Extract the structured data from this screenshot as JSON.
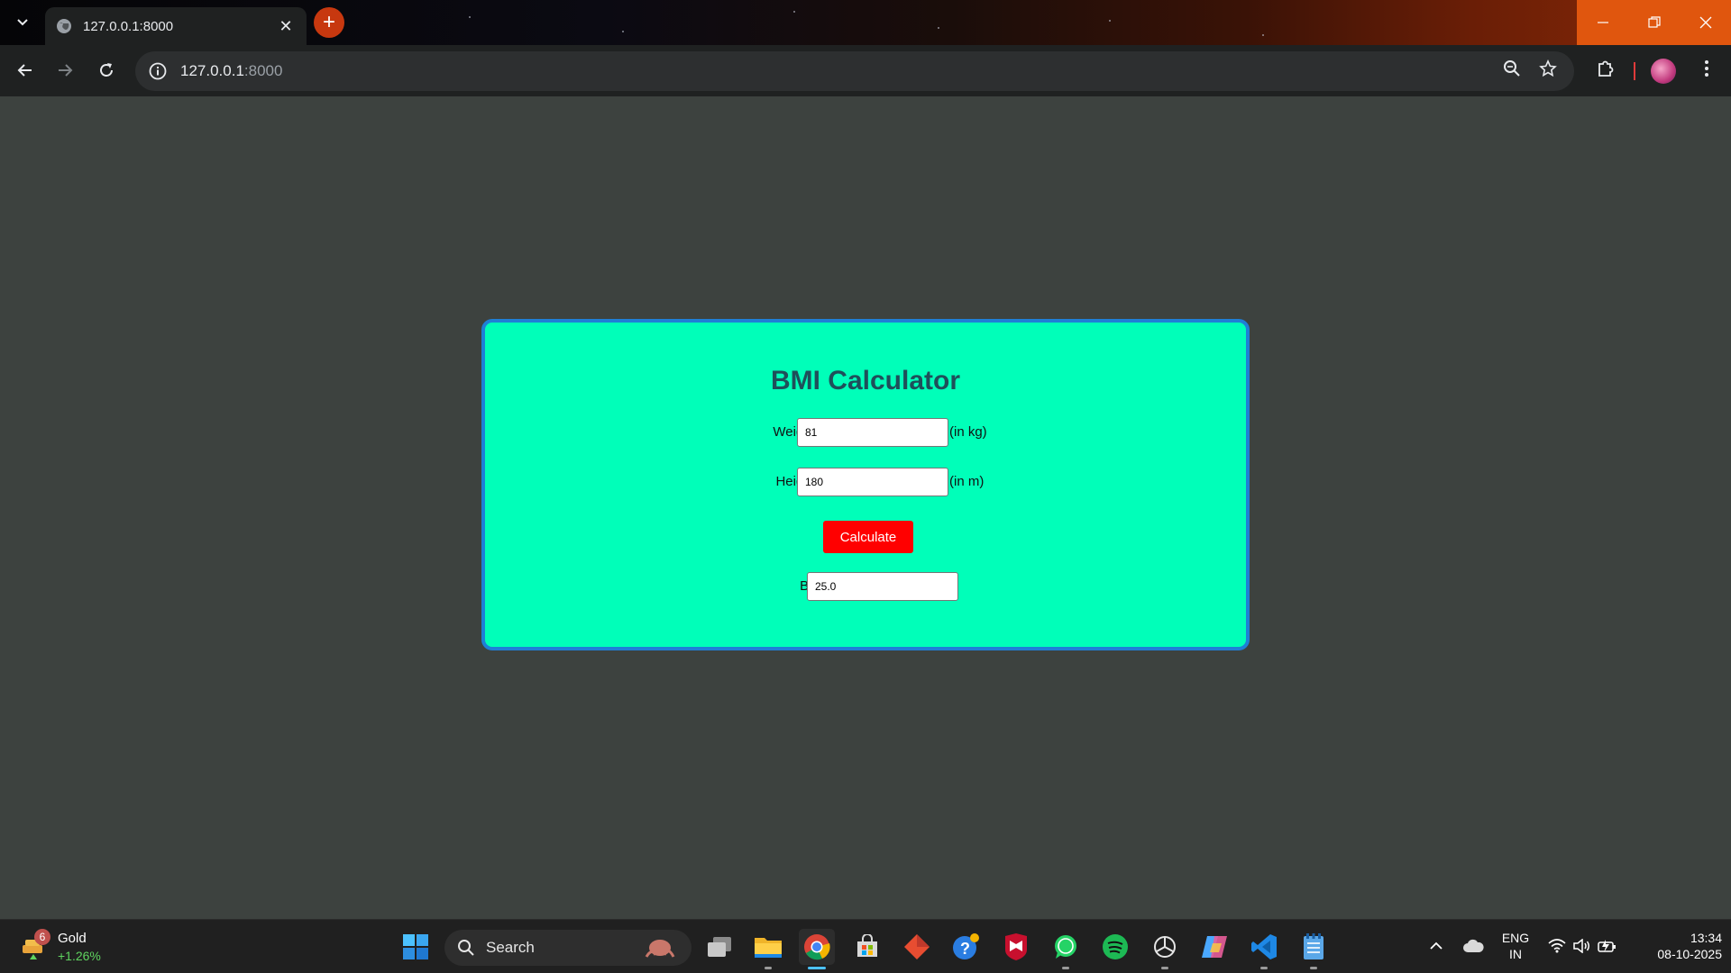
{
  "browser": {
    "tab_title": "127.0.0.1:8000",
    "new_tab_symbol": "+",
    "url_host": "127.0.0.1",
    "url_port": ":8000",
    "window_controls": {
      "minimize": "minimize-icon",
      "maximize": "restore-icon",
      "close": "close-icon"
    }
  },
  "page": {
    "heading": "BMI Calculator",
    "weight_label": "Weight:",
    "weight_value": "81",
    "weight_unit": "(in kg)",
    "height_label": "Height:",
    "height_value": "180",
    "height_unit": "(in m)",
    "calculate_label": "Calculate",
    "bmi_label": "BMI:",
    "bmi_value": "25.0",
    "colors": {
      "card_bg": "#00ffb9",
      "card_border": "#1f7fd6",
      "button_bg": "#ff0000",
      "page_bg": "#3d423f"
    }
  },
  "taskbar": {
    "widget": {
      "badge": "6",
      "name": "Gold",
      "change": "+1.26%"
    },
    "search_label": "Search",
    "apps": [
      "start-icon",
      "task-view-icon",
      "file-explorer-icon",
      "chrome-icon",
      "microsoft-store-icon",
      "git-icon",
      "help-icon",
      "mcafee-icon",
      "whatsapp-icon",
      "spotify-icon",
      "chatgpt-icon",
      "copilot-icon",
      "vscode-icon",
      "notepad-icon"
    ],
    "tray": {
      "lang_line1": "ENG",
      "lang_line2": "IN",
      "time": "13:34",
      "date": "08-10-2025"
    }
  }
}
